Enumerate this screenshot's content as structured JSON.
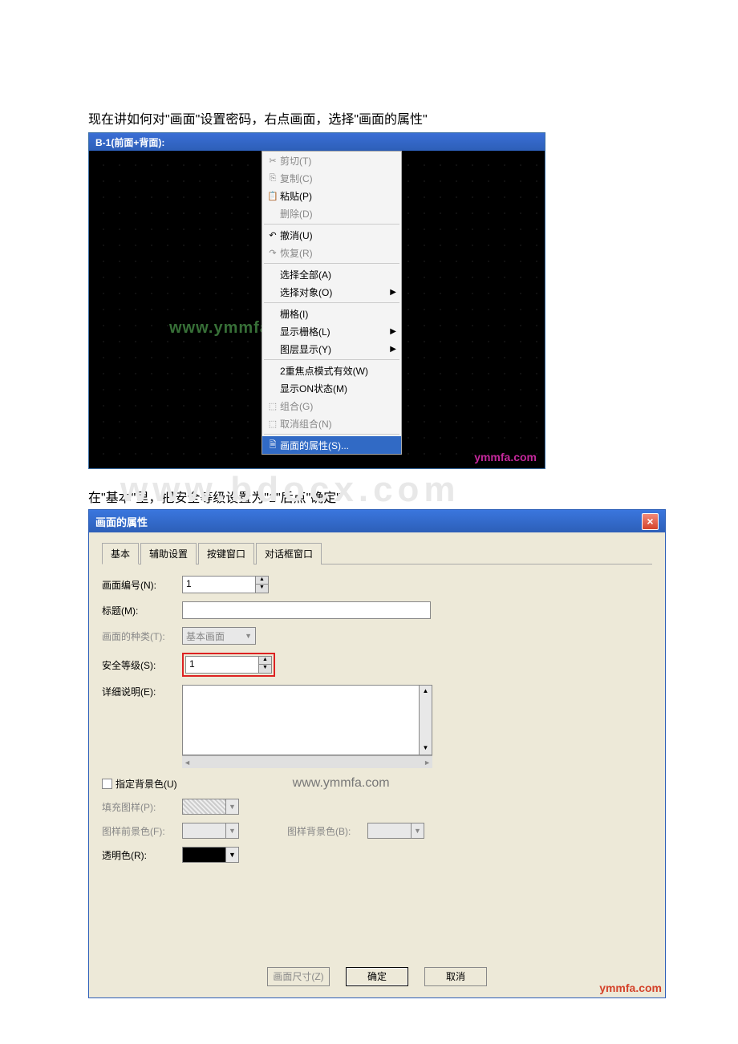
{
  "page": {
    "intro1": "现在讲如何对\"画面\"设置密码，右点画面，选择\"画面的属性\"",
    "intro2": "在\"基本\"里，把安全等级设置为\"1\"后点\"确定\""
  },
  "bigWatermark": "www.bdocx.com",
  "screenshot1": {
    "title": "B-1(前面+背面):",
    "overlay": "www.ymmfa.com",
    "watermark": "ymmfa.com",
    "menu": {
      "cut": "剪切(T)",
      "copy": "复制(C)",
      "paste": "粘贴(P)",
      "delete": "删除(D)",
      "undo": "撤消(U)",
      "redo": "恢复(R)",
      "selectAll": "选择全部(A)",
      "selectObj": "选择对象(O)",
      "grid": "栅格(I)",
      "showGrid": "显示栅格(L)",
      "layerShow": "图层显示(Y)",
      "doubleFocus": "2重焦点模式有效(W)",
      "showOn": "显示ON状态(M)",
      "group": "组合(G)",
      "ungroup": "取消组合(N)",
      "screenProp": "画面的属性(S)..."
    }
  },
  "dialog": {
    "title": "画面的属性",
    "tabs": {
      "basic": "基本",
      "aux": "辅助设置",
      "keywin": "按键窗口",
      "dlgwin": "对话框窗口"
    },
    "labels": {
      "screenNo": "画面编号(N):",
      "caption": "标题(M):",
      "screenType": "画面的种类(T):",
      "secLevel": "安全等级(S):",
      "detail": "详细说明(E):",
      "specBg": "指定背景色(U)",
      "fillPattern": "填充图样(P):",
      "fgColor": "图样前景色(F):",
      "bgColor": "图样背景色(B):",
      "transColor": "透明色(R):"
    },
    "values": {
      "screenNo": "1",
      "caption": "",
      "screenType": "基本画面",
      "secLevel": "1",
      "detail": "",
      "transColor": "#000000"
    },
    "watermark": "www.ymmfa.com",
    "buttons": {
      "size": "画面尺寸(Z)",
      "ok": "确定",
      "cancel": "取消"
    },
    "outerWatermark": "ymmfa.com"
  }
}
